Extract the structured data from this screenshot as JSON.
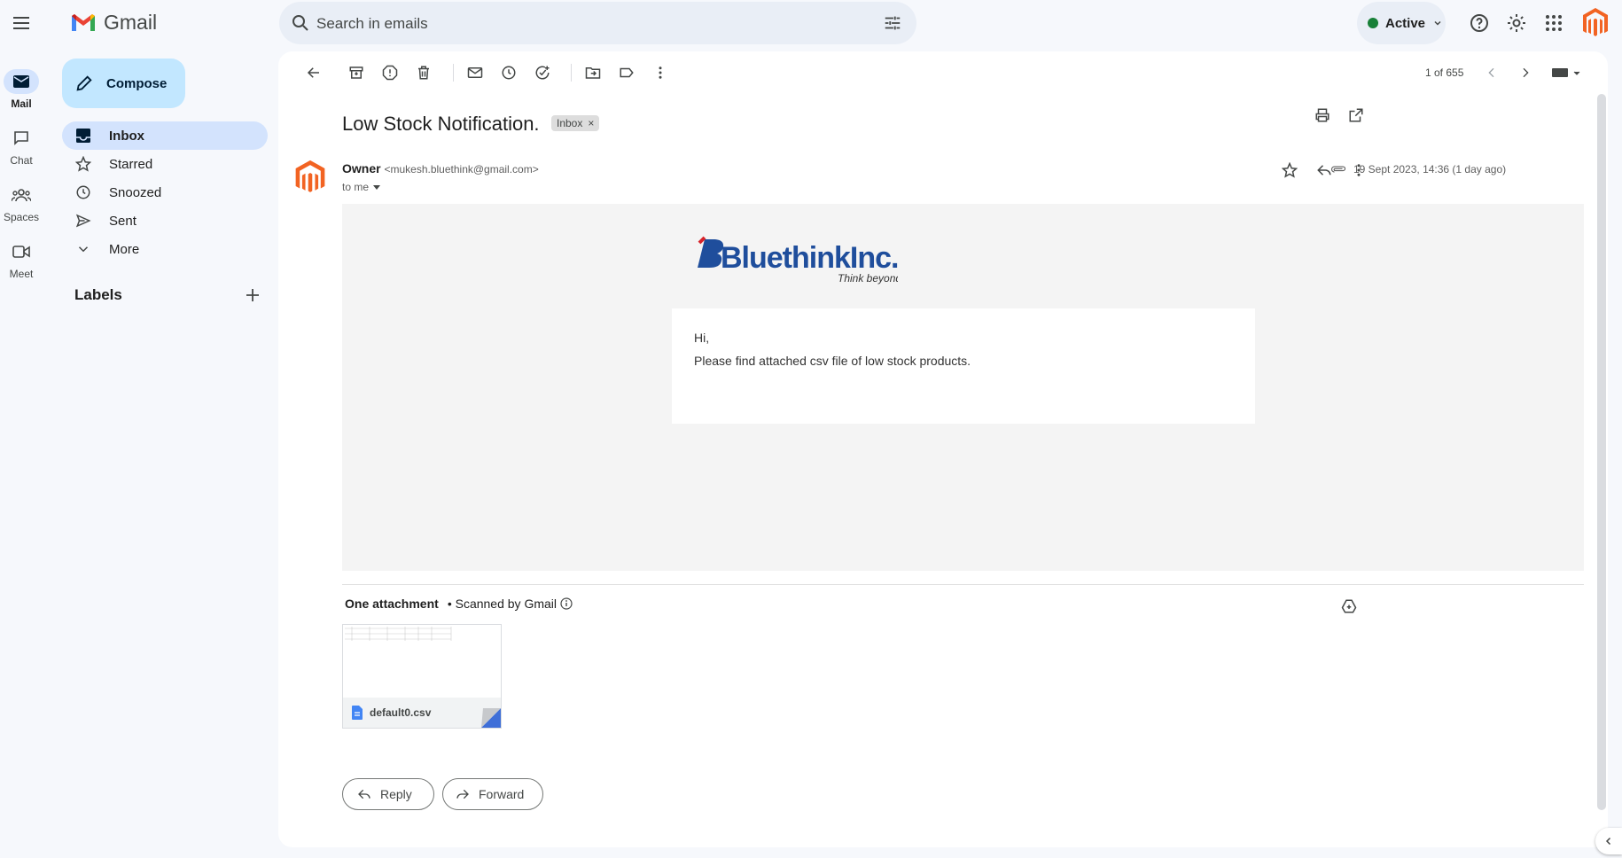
{
  "app": {
    "name": "Gmail"
  },
  "search": {
    "placeholder": "Search in emails"
  },
  "status": {
    "label": "Active",
    "color": "#188038"
  },
  "rail": [
    {
      "label": "Mail",
      "icon": "mail-icon"
    },
    {
      "label": "Chat",
      "icon": "chat-icon"
    },
    {
      "label": "Spaces",
      "icon": "spaces-icon"
    },
    {
      "label": "Meet",
      "icon": "meet-icon"
    }
  ],
  "compose": {
    "label": "Compose"
  },
  "nav": [
    {
      "label": "Inbox",
      "icon": "inbox-icon"
    },
    {
      "label": "Starred",
      "icon": "star-icon"
    },
    {
      "label": "Snoozed",
      "icon": "clock-icon"
    },
    {
      "label": "Sent",
      "icon": "send-icon"
    },
    {
      "label": "More",
      "icon": "chevron-down-icon"
    }
  ],
  "labels": {
    "heading": "Labels"
  },
  "toolbar": {
    "pager": "1 of 655"
  },
  "message": {
    "subject": "Low Stock Notification.",
    "chip": "Inbox",
    "sender_name": "Owner",
    "sender_email": "<mukesh.bluethink@gmail.com>",
    "to": "to me",
    "date": "19 Sept 2023, 14:36 (1 day ago)",
    "brand": {
      "name": "BluethinkInc.",
      "tagline": "Think beyond"
    },
    "greeting": "Hi,",
    "body": "Please find attached csv file of low stock products."
  },
  "attachments": {
    "heading": "One attachment",
    "scanned": "• Scanned by Gmail",
    "files": [
      {
        "name": "default0.csv"
      }
    ]
  },
  "actions": {
    "reply": "Reply",
    "forward": "Forward"
  },
  "colors": {
    "accent": "#0b57d0",
    "nav_active": "#d3e3fd",
    "compose": "#c2e7ff",
    "magento_orange": "#f26322"
  }
}
